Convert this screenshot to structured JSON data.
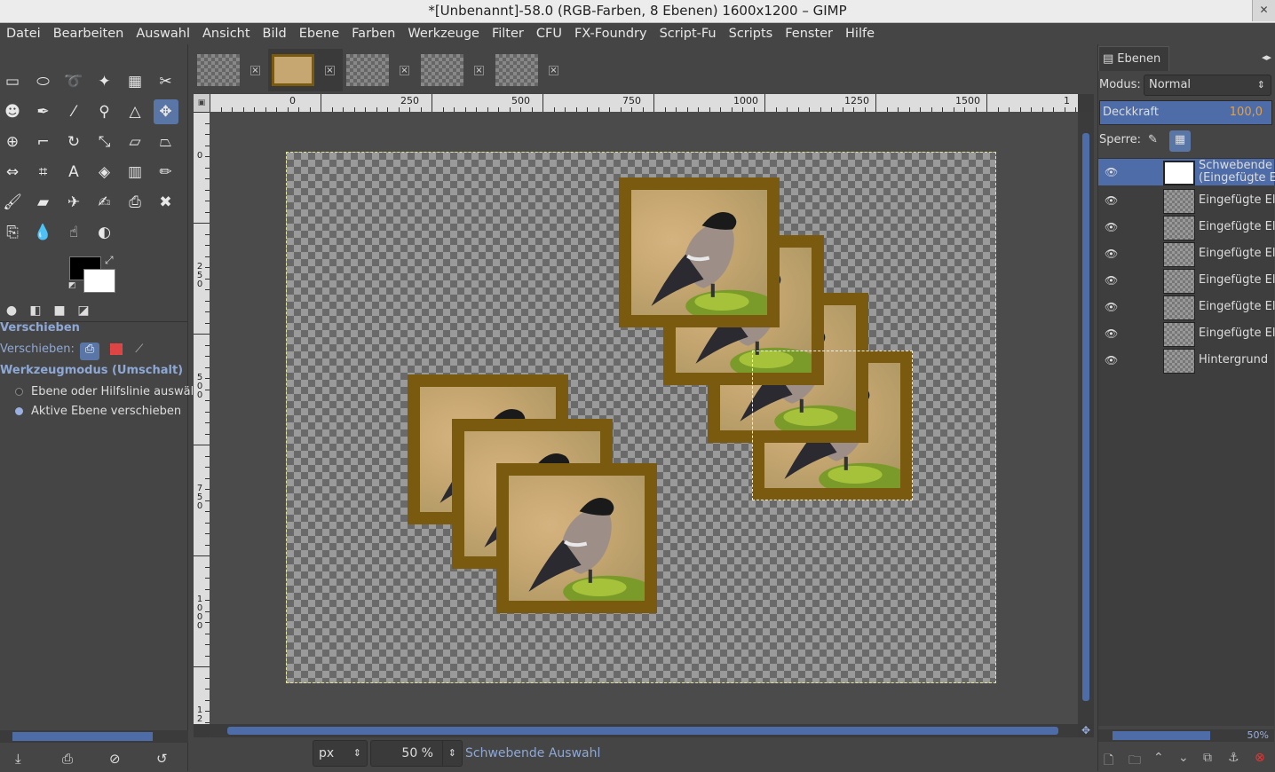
{
  "window": {
    "title": "*[Unbenannt]-58.0 (RGB-Farben, 8 Ebenen) 1600x1200 – GIMP",
    "close": "✕"
  },
  "menu": [
    "Datei",
    "Bearbeiten",
    "Auswahl",
    "Ansicht",
    "Bild",
    "Ebene",
    "Farben",
    "Werkzeuge",
    "Filter",
    "CFU",
    "FX-Foundry",
    "Script-Fu",
    "Scripts",
    "Fenster",
    "Hilfe"
  ],
  "toolbox": {
    "tools": [
      {
        "name": "rect-select-icon",
        "glyph": "▭"
      },
      {
        "name": "ellipse-select-icon",
        "glyph": "⬭"
      },
      {
        "name": "lasso-icon",
        "glyph": "➰"
      },
      {
        "name": "fuzzy-select-icon",
        "glyph": "✦"
      },
      {
        "name": "color-select-icon",
        "glyph": "▦"
      },
      {
        "name": "scissors-icon",
        "glyph": "✂"
      },
      {
        "name": "foreground-select-icon",
        "glyph": "☻"
      },
      {
        "name": "paths-icon",
        "glyph": "✒"
      },
      {
        "name": "color-picker-icon",
        "glyph": "⁄"
      },
      {
        "name": "zoom-icon",
        "glyph": "⚲"
      },
      {
        "name": "measure-icon",
        "glyph": "△"
      },
      {
        "name": "move-icon",
        "glyph": "✥"
      },
      {
        "name": "align-icon",
        "glyph": "⊕"
      },
      {
        "name": "crop-icon",
        "glyph": "⌐"
      },
      {
        "name": "rotate-icon",
        "glyph": "↻"
      },
      {
        "name": "scale-icon",
        "glyph": "⤡"
      },
      {
        "name": "shear-icon",
        "glyph": "▱"
      },
      {
        "name": "perspective-icon",
        "glyph": "⏢"
      },
      {
        "name": "flip-icon",
        "glyph": "⇔"
      },
      {
        "name": "cage-icon",
        "glyph": "⌗"
      },
      {
        "name": "text-icon",
        "glyph": "A"
      },
      {
        "name": "bucket-fill-icon",
        "glyph": "◈"
      },
      {
        "name": "gradient-icon",
        "glyph": "▥"
      },
      {
        "name": "pencil-icon",
        "glyph": "✏"
      },
      {
        "name": "paintbrush-icon",
        "glyph": "🖌"
      },
      {
        "name": "eraser-icon",
        "glyph": "▰"
      },
      {
        "name": "airbrush-icon",
        "glyph": "✈"
      },
      {
        "name": "ink-icon",
        "glyph": "✍"
      },
      {
        "name": "clone-icon",
        "glyph": "⎙"
      },
      {
        "name": "heal-icon",
        "glyph": "✖"
      },
      {
        "name": "perspective-clone-icon",
        "glyph": "⎘"
      },
      {
        "name": "blur-icon",
        "glyph": "💧"
      },
      {
        "name": "smudge-icon",
        "glyph": "☝"
      },
      {
        "name": "dodge-burn-icon",
        "glyph": "◐"
      }
    ],
    "active_tool_index": 11,
    "tabs": [
      "●",
      "◧",
      "■",
      "◪"
    ],
    "options": {
      "title": "Verschieben",
      "move_label": "Verschieben:",
      "mode_title": "Werkzeugmodus (Umschalt)",
      "radio1": "Ebene oder Hilfslinie auswäl",
      "radio2": "Aktive Ebene verschieben",
      "radio_selected": 2
    },
    "bottom_icons": [
      "⤓",
      "⎙",
      "⊘",
      "↺"
    ]
  },
  "image_tabs": [
    {
      "label": "thumb-1",
      "active": false
    },
    {
      "label": "thumb-2",
      "active": true
    },
    {
      "label": "thumb-3",
      "active": false
    },
    {
      "label": "thumb-4",
      "active": false
    },
    {
      "label": "thumb-5",
      "active": false
    }
  ],
  "rulers": {
    "h_ticks": [
      "0",
      "250",
      "500",
      "750",
      "1000",
      "1250",
      "1500",
      "1"
    ],
    "v_ticks": [
      "0",
      "2\n5\n0",
      "5\n0\n0",
      "7\n5\n0",
      "1\n0\n0\n0",
      "1\n2"
    ]
  },
  "status": {
    "unit": "px",
    "zoom": "50 %",
    "message": "Schwebende Auswahl"
  },
  "layers_panel": {
    "tab": "Ebenen",
    "mode_label": "Modus:",
    "mode_value": "Normal",
    "opacity_label": "Deckkraft",
    "opacity_value": "100,0",
    "lock_label": "Sperre:",
    "layers": [
      {
        "name": "Schwebende\n(Eingefügte E",
        "selected": true
      },
      {
        "name": "Eingefügte El",
        "selected": false
      },
      {
        "name": "Eingefügte El",
        "selected": false
      },
      {
        "name": "Eingefügte El",
        "selected": false
      },
      {
        "name": "Eingefügte El",
        "selected": false
      },
      {
        "name": "Eingefügte El",
        "selected": false
      },
      {
        "name": "Eingefügte El",
        "selected": false
      },
      {
        "name": "Hintergrund",
        "selected": false
      }
    ],
    "zoom": "50%"
  },
  "colors": {
    "accent": "#4d6ca8",
    "frame": "#7a5a0e",
    "foreground": "#000000",
    "background": "#ffffff"
  }
}
